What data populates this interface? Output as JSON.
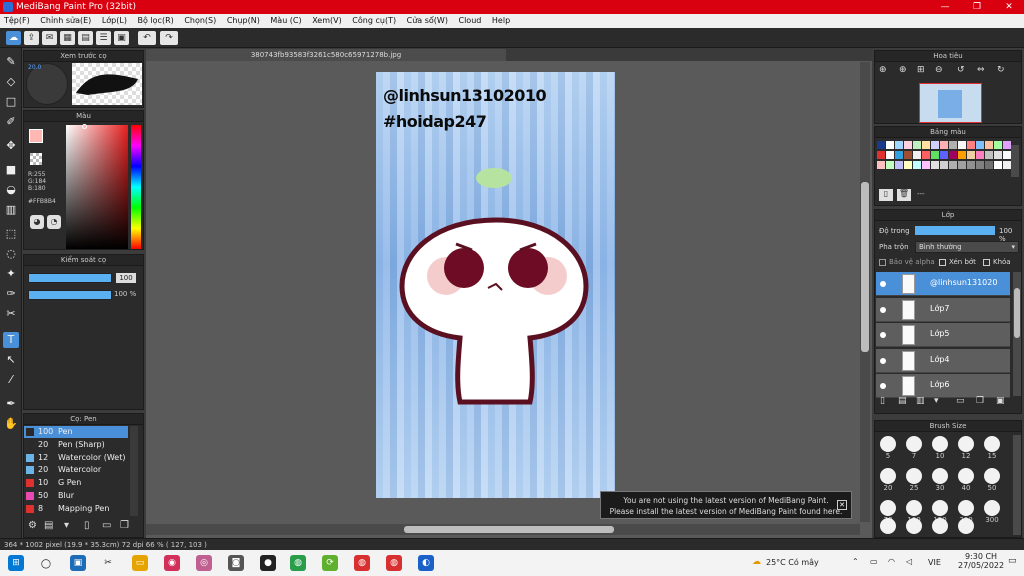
{
  "window": {
    "title": "MediBang Paint Pro (32bit)",
    "controls": [
      "—",
      "❐",
      "✕"
    ]
  },
  "menu": [
    "Tệp(F)",
    "Chỉnh sửa(E)",
    "Lớp(L)",
    "Bộ lọc(R)",
    "Chọn(S)",
    "Chụp(N)",
    "Màu (C)",
    "Xem(V)",
    "Công cụ(T)",
    "Cửa sổ(W)",
    "Cloud",
    "Help"
  ],
  "document": {
    "tab_name": "380743fb93583f3261c580c65971278b.jpg",
    "art_line1": "@linhsun13102010",
    "art_line2": "#hoidap247"
  },
  "preview_panel": {
    "title": "Xem trước cọ",
    "badge": "20.0"
  },
  "color_panel": {
    "title": "Màu",
    "r": "R:255",
    "g": "G:184",
    "b": "B:180",
    "hex": "#FFB8B4",
    "fg_color": "#FFB8B4"
  },
  "brush_control": {
    "title": "Kiểm soát cọ",
    "size_value": "100",
    "opacity_value": "100 %"
  },
  "brush_panel": {
    "title": "Cọ: Pen",
    "items": [
      {
        "size": "100",
        "name": "Pen",
        "color": "#2a2a2a"
      },
      {
        "size": "20",
        "name": "Pen (Sharp)",
        "color": "#2a2a2a"
      },
      {
        "size": "12",
        "name": "Watercolor (Wet)",
        "color": "#6ab4e8"
      },
      {
        "size": "20",
        "name": "Watercolor",
        "color": "#6ab4e8"
      },
      {
        "size": "10",
        "name": "G Pen",
        "color": "#e03030"
      },
      {
        "size": "50",
        "name": "Blur",
        "color": "#e84ab0"
      },
      {
        "size": "8",
        "name": "Mapping Pen",
        "color": "#e03030"
      }
    ]
  },
  "navigator": {
    "title": "Hoa tiêu"
  },
  "palette": {
    "title": "Bảng màu",
    "footer": "---",
    "colors": [
      "#1a3a8a",
      "#ffffff",
      "#a0d8ff",
      "#ffd0e0",
      "#c0f0c0",
      "#ffe0a0",
      "#d0d0ff",
      "#ffb0b0",
      "#b0b0b0",
      "#f8f8f8",
      "#ff8080",
      "#80c0ff",
      "#ffc0a0",
      "#a0ffa0",
      "#e0a0ff",
      "#ffe070",
      "#e03030",
      "#ffffff",
      "#30a0e0",
      "#a05030",
      "#f0f0f0",
      "#ff6060",
      "#60e060",
      "#6060ff",
      "#a00060",
      "#ffa000",
      "#f0d0a0",
      "#ff80c0",
      "#c0c0c0",
      "#e0e0e0",
      "#ffffff",
      "#d0d0d0",
      "#ffc0c0",
      "#c0ffc0",
      "#c0c0ff",
      "#ffffc0",
      "#c0ffff",
      "#ffc0ff",
      "#e0e0e0",
      "#d0d0d0",
      "#b0b0b0",
      "#a0a0a0",
      "#909090",
      "#808080",
      "#707070",
      "#ffffff",
      "#f0f0f0",
      "#ffe0e0"
    ]
  },
  "layers": {
    "title": "Lớp",
    "opacity_label": "Độ trong",
    "opacity_value": "100 %",
    "blend_label": "Pha trộn",
    "blend_value": "Bình thường",
    "protect_alpha": "Bảo vệ alpha",
    "clipping": "Xén bớt",
    "lock": "Khóa",
    "rows": [
      "@linhsun131020",
      "Lớp7",
      "Lớp5",
      "Lớp4",
      "Lớp6"
    ]
  },
  "brush_size": {
    "title": "Brush Size",
    "row1": [
      "5",
      "7",
      "10",
      "12",
      "15"
    ],
    "row2": [
      "20",
      "25",
      "30",
      "40",
      "50"
    ],
    "row3": [
      "70",
      "100",
      "150",
      "200",
      "300"
    ]
  },
  "notice": {
    "line1": "You are not using the latest version of MediBang Paint.",
    "line2": "Please install the latest version of MediBang Paint found here."
  },
  "status": {
    "text": "364 * 1002 pixel   (19.9 * 35.3cm)   72 dpi   66 %   ( 127, 103 )"
  },
  "taskbar": {
    "weather": "25°C  Có mây",
    "lang": "VIE",
    "time": "9:30 CH",
    "date": "27/05/2022"
  }
}
